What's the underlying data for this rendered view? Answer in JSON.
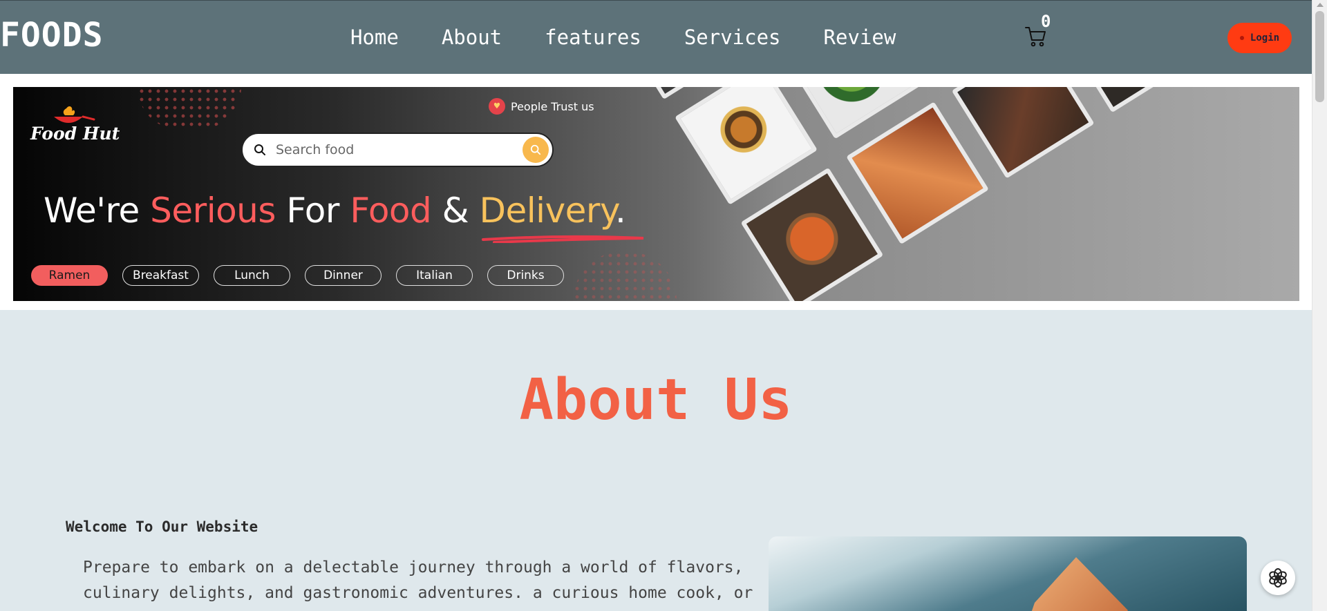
{
  "nav": {
    "brand": "FOODS",
    "links": [
      "Home",
      "About",
      "features",
      "Services",
      "Review"
    ],
    "cart_count": "0",
    "login_label": "Login"
  },
  "hero": {
    "logo_text": "Food Hut",
    "trust_text": "People Trust us",
    "search_placeholder": "Search food",
    "headline": {
      "w1": "We're ",
      "w2": "Serious",
      "w3": " For ",
      "w4": "Food",
      "w5": " & ",
      "w6": "Delivery",
      "w7": "."
    },
    "chips": [
      "Ramen",
      "Breakfast",
      "Lunch",
      "Dinner",
      "Italian",
      "Drinks"
    ],
    "active_chip": "Ramen"
  },
  "about": {
    "title": "About Us",
    "welcome": "Welcome To Our Website",
    "text": "Prepare to embark on a delectable journey through a world of flavors, culinary delights, and gastronomic adventures. a curious home cook, or"
  },
  "colors": {
    "navbar": "#5d7279",
    "accent_red": "#ff5d5d",
    "accent_yellow": "#f8c25c",
    "login_bg": "#ff3b12",
    "about_title": "#f26145",
    "page_bg": "#dfe8ec"
  },
  "icons": {
    "cart": "shopping-cart-icon",
    "search": "magnifier-icon",
    "trust": "heart-icon",
    "assistant": "openai-logo-icon"
  }
}
